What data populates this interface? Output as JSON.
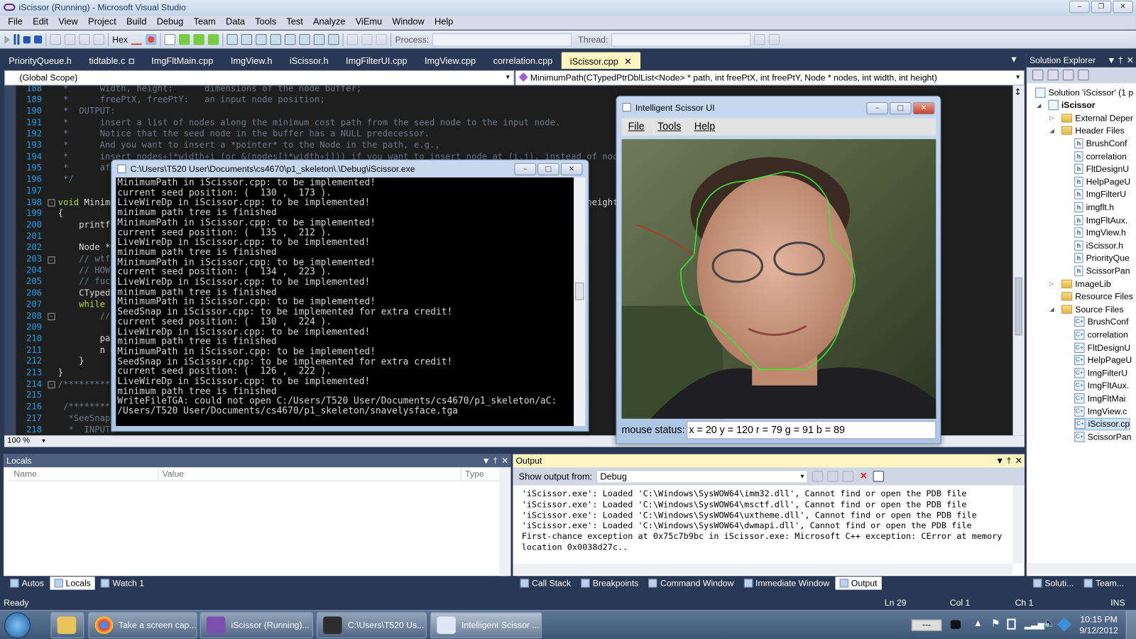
{
  "window": {
    "title": "iScissor (Running) - Microsoft Visual Studio"
  },
  "menu": [
    "File",
    "Edit",
    "View",
    "Project",
    "Build",
    "Debug",
    "Team",
    "Data",
    "Tools",
    "Test",
    "Analyze",
    "ViEmu",
    "Window",
    "Help"
  ],
  "toolbar": {
    "hex_label": "Hex",
    "process_label": "Process:",
    "thread_label": "Thread:"
  },
  "tabs": [
    {
      "label": "PriorityQueue.h"
    },
    {
      "label": "tidtable.c",
      "locked": true
    },
    {
      "label": "ImgFltMain.cpp"
    },
    {
      "label": "ImgView.h"
    },
    {
      "label": "iScissor.h"
    },
    {
      "label": "ImgFilterUI.cpp"
    },
    {
      "label": "ImgView.cpp"
    },
    {
      "label": "correlation.cpp"
    },
    {
      "label": "iScissor.cpp",
      "active": true
    }
  ],
  "scope": {
    "left": "(Global Scope)",
    "right": "MinimumPath(CTypedPtrDblList<Node> * path, int freePtX, int freePtY, Node * nodes, int width, int height)"
  },
  "editor": {
    "zoom": "100 %",
    "lines": [
      {
        "n": "188",
        "t": " *      width, height:      dimensions of the node buffer;",
        "c": true
      },
      {
        "n": "189",
        "t": " *      freePtX, freePtY:   an input node position;",
        "c": true
      },
      {
        "n": "190",
        "t": " *  OUTPUT:",
        "c": true
      },
      {
        "n": "191",
        "t": " *      insert a list of nodes along the minimum cost path from the seed node to the input node.",
        "c": true
      },
      {
        "n": "192",
        "t": " *      Notice that the seed node in the buffer has a NULL predecessor.",
        "c": true
      },
      {
        "n": "193",
        "t": " *      And you want to insert a *pointer* to the Node in the path, e.g.,",
        "c": true
      },
      {
        "n": "194",
        "t": " *      insert nodes+j*width+i (or &(nodes[j*width+i])) if you want to insert node at (i,j), instead of nodes[no",
        "c": true
      },
      {
        "n": "195",
        "t": " *      aft",
        "c": true
      },
      {
        "n": "196",
        "t": " */",
        "c": true
      },
      {
        "n": "197",
        "t": ""
      },
      {
        "n": "198",
        "t": "void MinimumPath(CTypedPtrDblList<Node> *path, int freePtX, int freePtY, Node *nodes, int width, int height)",
        "kw": "void"
      },
      {
        "n": "199",
        "t": "{"
      },
      {
        "n": "200",
        "t": "    printf("
      },
      {
        "n": "201",
        "t": ""
      },
      {
        "n": "202",
        "t": "    Node *n"
      },
      {
        "n": "203",
        "t": "    // wtf",
        "c": true
      },
      {
        "n": "204",
        "t": "    // HOW",
        "c": true
      },
      {
        "n": "205",
        "t": "    // fuck",
        "c": true
      },
      {
        "n": "206",
        "t": "    CTypedP"
      },
      {
        "n": "207",
        "t": "    while (",
        "kw": "while"
      },
      {
        "n": "208",
        "t": "        //i",
        "c": true
      },
      {
        "n": "209",
        "t": ""
      },
      {
        "n": "210",
        "t": "        pat"
      },
      {
        "n": "211",
        "t": "        n ="
      },
      {
        "n": "212",
        "t": "    }"
      },
      {
        "n": "213",
        "t": "}"
      },
      {
        "n": "214",
        "t": "/**********",
        "c": true
      },
      {
        "n": "215",
        "t": ""
      },
      {
        "n": "216",
        "t": " /**********",
        "c": true
      },
      {
        "n": "217",
        "t": "  *SeeSnap:",
        "c": true
      },
      {
        "n": "218",
        "t": "  *  INPUT:",
        "c": true
      }
    ]
  },
  "console": {
    "title": "C:\\Users\\T520 User\\Documents\\cs4670\\p1_skeleton\\.\\Debug\\iScissor.exe",
    "lines": [
      "MinimumPath in iScissor.cpp: to be implemented!",
      "current seed position: (  130 ,  173 ).",
      "LiveWireDp in iScissor.cpp: to be implemented!",
      "minimum path tree is finished",
      "MinimumPath in iScissor.cpp: to be implemented!",
      "current seed position: (  135 ,  212 ).",
      "LiveWireDp in iScissor.cpp: to be implemented!",
      "minimum path tree is finished",
      "MinimumPath in iScissor.cpp: to be implemented!",
      "current seed position: (  134 ,  223 ).",
      "LiveWireDp in iScissor.cpp: to be implemented!",
      "minimum path tree is finished",
      "MinimumPath in iScissor.cpp: to be implemented!",
      "SeedSnap in iScissor.cpp: to be implemented for extra credit!",
      "current seed position: (  130 ,  224 ).",
      "LiveWireDp in iScissor.cpp: to be implemented!",
      "minimum path tree is finished",
      "MinimumPath in iScissor.cpp: to be implemented!",
      "SeedSnap in iScissor.cpp: to be implemented for extra credit!",
      "current seed position: (  126 ,  222 ).",
      "LiveWireDp in iScissor.cpp: to be implemented!",
      "minimum path tree is finished",
      "WriteFileTGA: could not open C:/Users/T520 User/Documents/cs4670/p1_skeleton/aC:",
      "/Users/T520 User/Documents/cs4670/p1_skeleton/snavelysface.tga"
    ]
  },
  "scissor": {
    "title": "Intelligent Scissor UI",
    "menu": [
      "File",
      "Tools",
      "Help"
    ],
    "status_label": "mouse status:",
    "status_value": "x = 20 y = 120 r = 79 g = 91 b = 89",
    "contour_color": "#33ee33",
    "wire_color": "#e02020"
  },
  "solution": {
    "title": "Solution Explorer",
    "items": [
      {
        "label": "Solution 'iScissor' (1 p",
        "icon": "solution",
        "indent": 0
      },
      {
        "label": "iScissor",
        "icon": "project",
        "indent": 1,
        "bold": true
      },
      {
        "label": "External Deper",
        "icon": "folder",
        "indent": 2
      },
      {
        "label": "Header Files",
        "icon": "folder",
        "indent": 2
      },
      {
        "label": "BrushConf",
        "icon": "h",
        "indent": 3
      },
      {
        "label": "correlation",
        "icon": "h",
        "indent": 3
      },
      {
        "label": "FltDesignU",
        "icon": "h",
        "indent": 3
      },
      {
        "label": "HelpPageU",
        "icon": "h",
        "indent": 3
      },
      {
        "label": "ImgFilterU",
        "icon": "h",
        "indent": 3
      },
      {
        "label": "imgflt.h",
        "icon": "h",
        "indent": 3
      },
      {
        "label": "ImgFltAux.",
        "icon": "h",
        "indent": 3
      },
      {
        "label": "ImgView.h",
        "icon": "h",
        "indent": 3
      },
      {
        "label": "iScissor.h",
        "icon": "h",
        "indent": 3
      },
      {
        "label": "PriorityQue",
        "icon": "h",
        "indent": 3
      },
      {
        "label": "ScissorPan",
        "icon": "h",
        "indent": 3
      },
      {
        "label": "ImageLib",
        "icon": "folder",
        "indent": 2
      },
      {
        "label": "Resource Files",
        "icon": "folder",
        "indent": 2
      },
      {
        "label": "Source Files",
        "icon": "folder",
        "indent": 2
      },
      {
        "label": "BrushConf",
        "icon": "cpp",
        "indent": 3
      },
      {
        "label": "correlation",
        "icon": "cpp",
        "indent": 3
      },
      {
        "label": "FltDesignU",
        "icon": "cpp",
        "indent": 3
      },
      {
        "label": "HelpPageU",
        "icon": "cpp",
        "indent": 3
      },
      {
        "label": "ImgFilterU",
        "icon": "cpp",
        "indent": 3
      },
      {
        "label": "ImgFltAux.",
        "icon": "cpp",
        "indent": 3
      },
      {
        "label": "ImgFltMai",
        "icon": "cpp",
        "indent": 3
      },
      {
        "label": "ImgView.c",
        "icon": "cpp",
        "indent": 3
      },
      {
        "label": "iScissor.cp",
        "icon": "cpp",
        "indent": 3,
        "selected": true
      },
      {
        "label": "ScissorPan",
        "icon": "cpp",
        "indent": 3
      }
    ],
    "bottom_tabs": [
      "Soluti...",
      "Team..."
    ]
  },
  "locals": {
    "title": "Locals",
    "columns": [
      "Name",
      "Value",
      "Type"
    ]
  },
  "output": {
    "title": "Output",
    "show_from_label": "Show output from:",
    "source": "Debug",
    "lines": [
      "'iScissor.exe': Loaded 'C:\\Windows\\SysWOW64\\imm32.dll', Cannot find or open the PDB file",
      "'iScissor.exe': Loaded 'C:\\Windows\\SysWOW64\\msctf.dll', Cannot find or open the PDB file",
      "'iScissor.exe': Loaded 'C:\\Windows\\SysWOW64\\uxtheme.dll', Cannot find or open the PDB file",
      "'iScissor.exe': Loaded 'C:\\Windows\\SysWOW64\\dwmapi.dll', Cannot find or open the PDB file",
      "First-chance exception at 0x75c7b9bc in iScissor.exe: Microsoft C++ exception: CError at memory",
      "location 0x0038d27c.."
    ]
  },
  "bottom_tabs_left": [
    {
      "label": "Autos"
    },
    {
      "label": "Locals",
      "active": true
    },
    {
      "label": "Watch 1"
    }
  ],
  "bottom_tabs_right": [
    {
      "label": "Call Stack"
    },
    {
      "label": "Breakpoints"
    },
    {
      "label": "Command Window"
    },
    {
      "label": "Immediate Window"
    },
    {
      "label": "Output",
      "active": true
    }
  ],
  "statusbar": {
    "state": "Ready",
    "ln": "Ln 29",
    "col": "Col 1",
    "ch": "Ch 1",
    "mode": "INS"
  },
  "taskbar": {
    "items": [
      {
        "label": "",
        "icon": "explorer-folder"
      },
      {
        "label": "Take a screen cap...",
        "icon": "chrome"
      },
      {
        "label": "iScissor (Running)...",
        "icon": "visual-studio"
      },
      {
        "label": "C:\\Users\\T520 Us...",
        "icon": "console"
      },
      {
        "label": "Intelligent Scissor ...",
        "icon": "app-window",
        "active": true
      }
    ],
    "battery": "---",
    "time": "10:15 PM",
    "date": "9/12/2012"
  }
}
